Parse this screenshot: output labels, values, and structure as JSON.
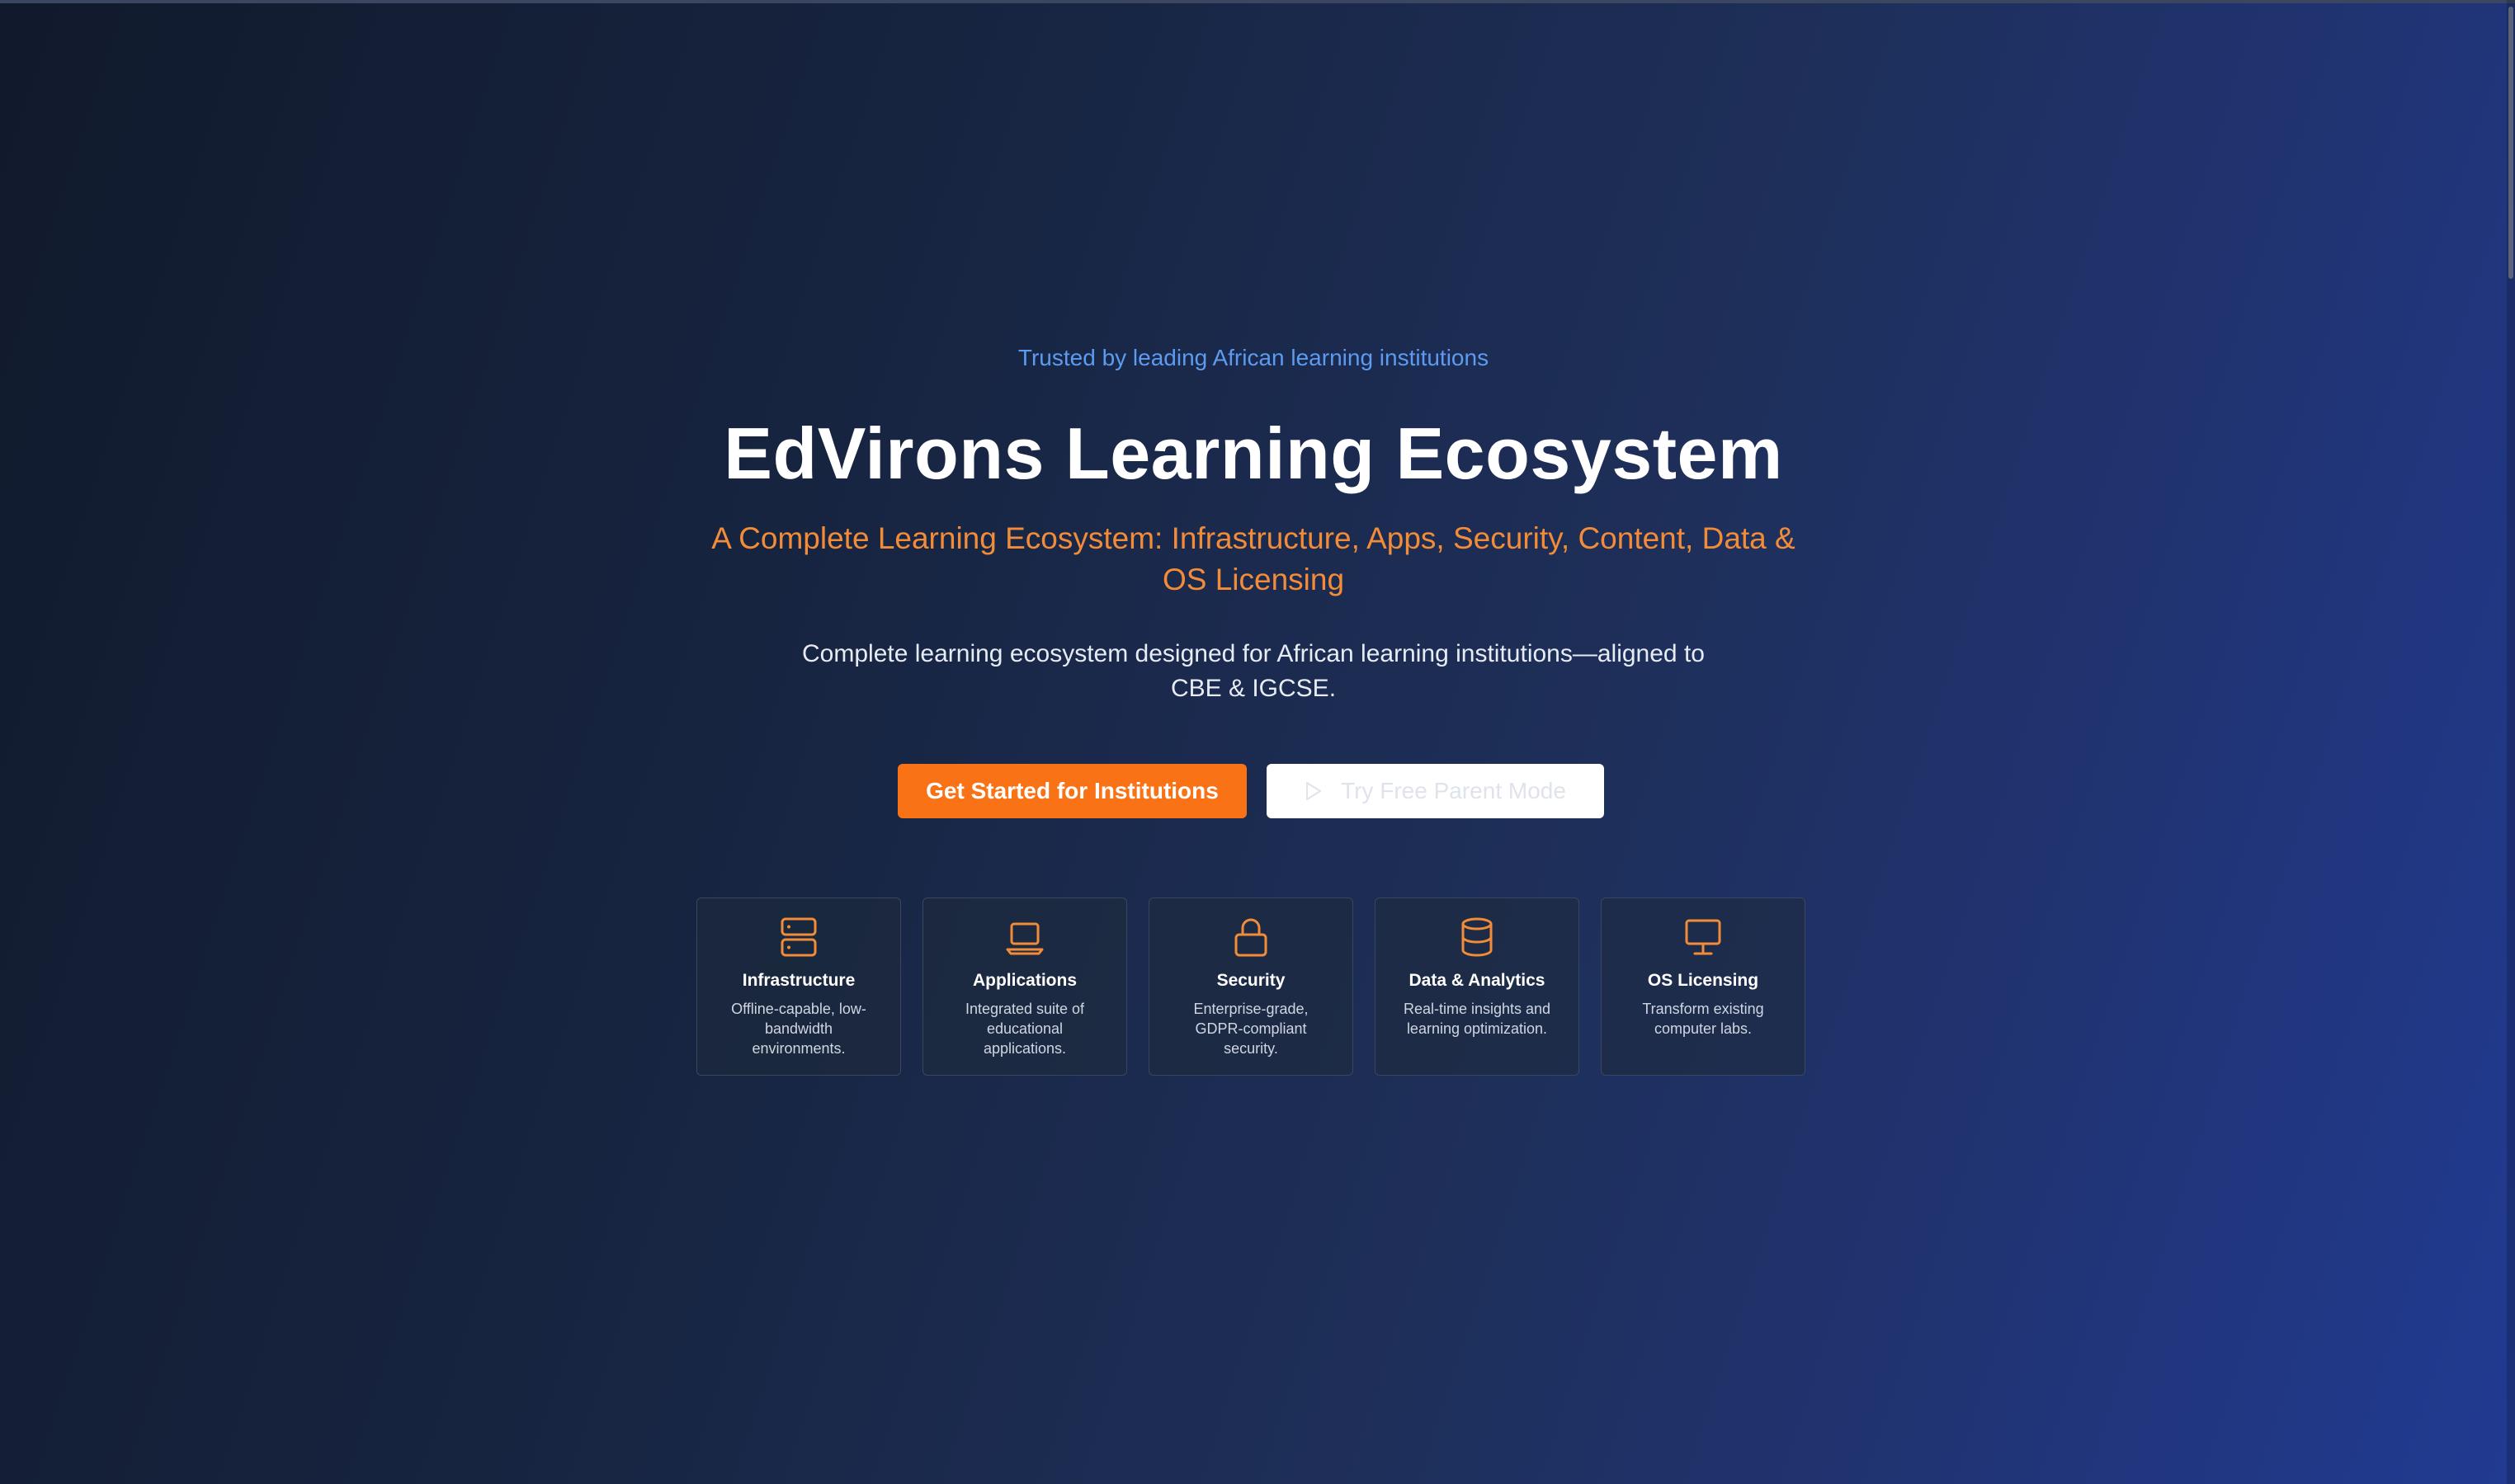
{
  "hero": {
    "eyebrow": "Trusted by leading African learning institutions",
    "title": "EdVirons Learning Ecosystem",
    "subtitle": "A Complete Learning Ecosystem: Infrastructure, Apps, Security, Content, Data & OS Licensing",
    "description": "Complete learning ecosystem designed for African learning institutions—aligned to CBE & IGCSE."
  },
  "buttons": {
    "primary_label": "Get Started for Institutions",
    "secondary_label": "Try Free Parent Mode",
    "secondary_icon": "play-icon"
  },
  "features": [
    {
      "icon": "server-icon",
      "title": "Infrastructure",
      "text": "Offline-capable, low-bandwidth environments."
    },
    {
      "icon": "laptop-icon",
      "title": "Applications",
      "text": "Integrated suite of educational applications."
    },
    {
      "icon": "lock-icon",
      "title": "Security",
      "text": "Enterprise-grade, GDPR-compliant security."
    },
    {
      "icon": "database-icon",
      "title": "Data & Analytics",
      "text": "Real-time insights and learning optimization."
    },
    {
      "icon": "monitor-icon",
      "title": "OS Licensing",
      "text": "Transform existing computer labs."
    }
  ],
  "colors": {
    "accent": "#f97316",
    "accent_text": "#f28c38",
    "eyebrow": "#5c9bf0",
    "background_start": "#111a2c",
    "background_end": "#213b92"
  }
}
